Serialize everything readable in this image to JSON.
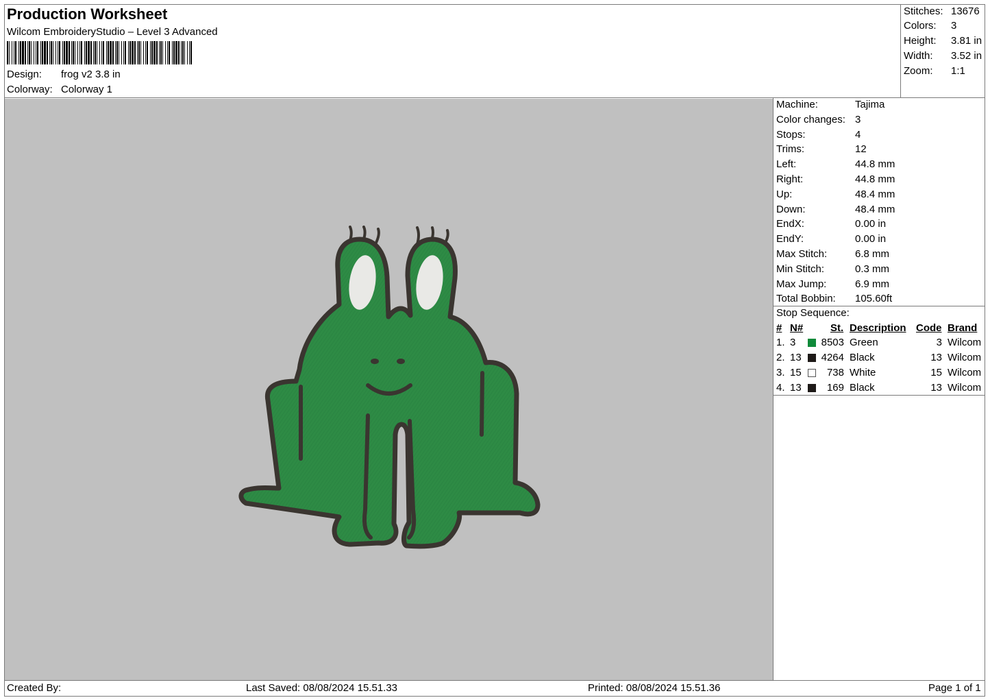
{
  "header": {
    "title": "Production Worksheet",
    "software": "Wilcom EmbroideryStudio – Level 3 Advanced",
    "design_label": "Design:",
    "design_value": "frog v2 3.8 in",
    "colorway_label": "Colorway:",
    "colorway_value": "Colorway 1"
  },
  "summary": [
    {
      "label": "Stitches:",
      "value": "13676"
    },
    {
      "label": "Colors:",
      "value": "3"
    },
    {
      "label": "Height:",
      "value": "3.81 in"
    },
    {
      "label": "Width:",
      "value": "3.52 in"
    },
    {
      "label": "Zoom:",
      "value": "1:1"
    }
  ],
  "details": [
    {
      "label": "Machine:",
      "value": "Tajima"
    },
    {
      "label": "Color changes:",
      "value": "3"
    },
    {
      "label": "Stops:",
      "value": "4"
    },
    {
      "label": "Trims:",
      "value": "12"
    },
    {
      "label": "Left:",
      "value": "44.8 mm"
    },
    {
      "label": "Right:",
      "value": "44.8 mm"
    },
    {
      "label": "Up:",
      "value": "48.4 mm"
    },
    {
      "label": "Down:",
      "value": "48.4 mm"
    },
    {
      "label": "EndX:",
      "value": "0.00 in"
    },
    {
      "label": "EndY:",
      "value": "0.00 in"
    },
    {
      "label": "Max Stitch:",
      "value": "6.8 mm"
    },
    {
      "label": "Min Stitch:",
      "value": "0.3 mm"
    },
    {
      "label": "Max Jump:",
      "value": "6.9 mm"
    },
    {
      "label": "Total Bobbin:",
      "value": "105.60ft"
    }
  ],
  "stop_sequence": {
    "title": "Stop Sequence:",
    "headers": {
      "num": "#",
      "needle": "N#",
      "stitches": "St.",
      "description": "Description",
      "code": "Code",
      "brand": "Brand"
    },
    "rows": [
      {
        "num": "1.",
        "needle": "3",
        "color": "#0f8a3a",
        "stitches": "8503",
        "description": "Green",
        "code": "3",
        "brand": "Wilcom"
      },
      {
        "num": "2.",
        "needle": "13",
        "color": "#1e1a18",
        "stitches": "4264",
        "description": "Black",
        "code": "13",
        "brand": "Wilcom"
      },
      {
        "num": "3.",
        "needle": "15",
        "color": "#ffffff",
        "stitches": "738",
        "description": "White",
        "code": "15",
        "brand": "Wilcom"
      },
      {
        "num": "4.",
        "needle": "13",
        "color": "#1e1a18",
        "stitches": "169",
        "description": "Black",
        "code": "13",
        "brand": "Wilcom"
      }
    ]
  },
  "footer": {
    "created_by": "Created By:",
    "last_saved": "Last Saved: 08/08/2024 15.51.33",
    "printed": "Printed: 08/08/2024 15.51.36",
    "page": "Page 1 of 1"
  },
  "design_preview": {
    "subject": "frog embroidery",
    "fill_color": "#2e8b45",
    "outline_color": "#3a3530",
    "eye_color": "#eaeaea",
    "background": "#c0c0c0"
  }
}
